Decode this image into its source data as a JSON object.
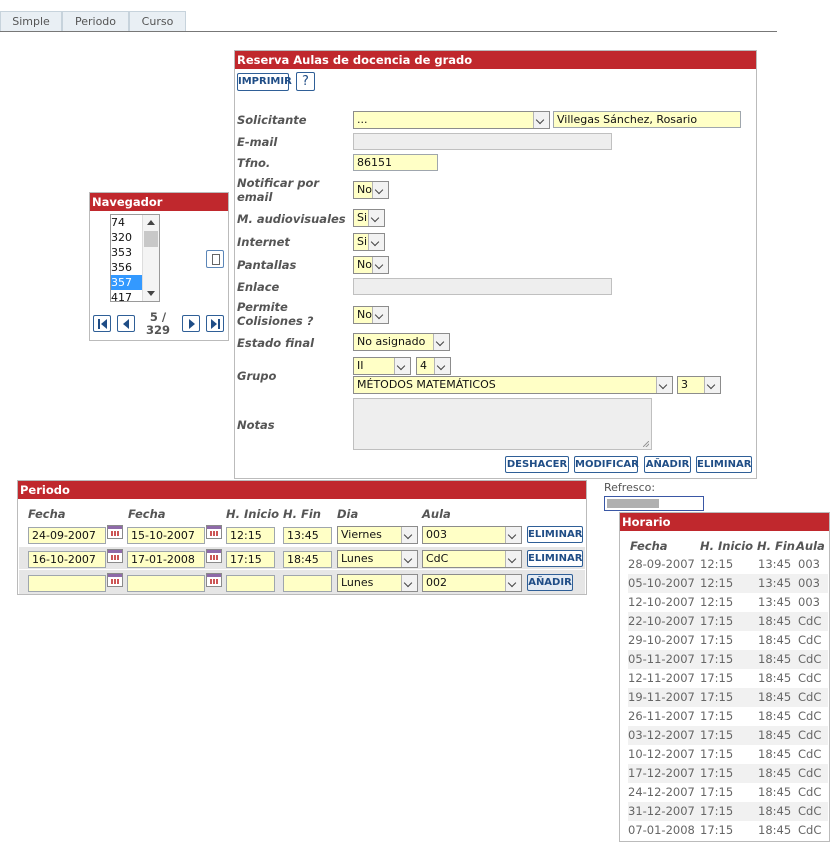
{
  "tabs": [
    "Simple",
    "Periodo",
    "Curso"
  ],
  "reserva": {
    "title": "Reserva Aulas de docencia de grado",
    "print_label": "IMPRIMIR",
    "help_label": "?",
    "labels": {
      "solicitante": "Solicitante",
      "email": "E-mail",
      "tfno": "Tfno.",
      "notificar": "Notificar por email",
      "audiovisuales": "M. audiovisuales",
      "internet": "Internet",
      "pantallas": "Pantallas",
      "enlace": "Enlace",
      "colisiones": "Permite Colisiones ?",
      "estado": "Estado final",
      "grupo": "Grupo",
      "notas": "Notas"
    },
    "values": {
      "solicitante_select": "...",
      "solicitante_name": "Villegas Sánchez, Rosario",
      "email": "",
      "tfno": "86151",
      "notificar": "No",
      "audiovisuales": "Si",
      "internet": "Si",
      "pantallas": "No",
      "enlace": "",
      "colisiones": "No",
      "estado": "No asignado",
      "grupo_a": "II",
      "grupo_b": "4",
      "asignatura": "MÉTODOS MATEMÁTICOS",
      "grupo_c": "3",
      "notas": ""
    },
    "buttons": {
      "deshacer": "DESHACER",
      "modificar": "MODIFICAR",
      "anadir": "AÑADIR",
      "eliminar": "ELIMINAR"
    }
  },
  "navegador": {
    "title": "Navegador",
    "items": [
      "74",
      "320",
      "353",
      "356",
      "357",
      "417"
    ],
    "selected": "357",
    "page": "5 /",
    "total": "329"
  },
  "periodo": {
    "title": "Periodo",
    "headers": [
      "Fecha",
      "Fecha",
      "H. Inicio",
      "H. Fin",
      "Dia",
      "Aula"
    ],
    "rows": [
      {
        "desde": "24-09-2007",
        "hasta": "15-10-2007",
        "inicio": "12:15",
        "fin": "13:45",
        "dia": "Viernes",
        "aula": "003",
        "action": "ELIMINAR"
      },
      {
        "desde": "16-10-2007",
        "hasta": "17-01-2008",
        "inicio": "17:15",
        "fin": "18:45",
        "dia": "Lunes",
        "aula": "CdC",
        "action": "ELIMINAR"
      },
      {
        "desde": "",
        "hasta": "",
        "inicio": "",
        "fin": "",
        "dia": "Lunes",
        "aula": "002",
        "action": "AÑADIR"
      }
    ]
  },
  "refresco": {
    "label": "Refresco:"
  },
  "horario": {
    "title": "Horario",
    "headers": [
      "Fecha",
      "H. Inicio",
      "H. Fin",
      "Aula"
    ],
    "rows": [
      [
        "28-09-2007",
        "12:15",
        "13:45",
        "003"
      ],
      [
        "05-10-2007",
        "12:15",
        "13:45",
        "003"
      ],
      [
        "12-10-2007",
        "12:15",
        "13:45",
        "003"
      ],
      [
        "22-10-2007",
        "17:15",
        "18:45",
        "CdC"
      ],
      [
        "29-10-2007",
        "17:15",
        "18:45",
        "CdC"
      ],
      [
        "05-11-2007",
        "17:15",
        "18:45",
        "CdC"
      ],
      [
        "12-11-2007",
        "17:15",
        "18:45",
        "CdC"
      ],
      [
        "19-11-2007",
        "17:15",
        "18:45",
        "CdC"
      ],
      [
        "26-11-2007",
        "17:15",
        "18:45",
        "CdC"
      ],
      [
        "03-12-2007",
        "17:15",
        "18:45",
        "CdC"
      ],
      [
        "10-12-2007",
        "17:15",
        "18:45",
        "CdC"
      ],
      [
        "17-12-2007",
        "17:15",
        "18:45",
        "CdC"
      ],
      [
        "24-12-2007",
        "17:15",
        "18:45",
        "CdC"
      ],
      [
        "31-12-2007",
        "17:15",
        "18:45",
        "CdC"
      ],
      [
        "07-01-2008",
        "17:15",
        "18:45",
        "CdC"
      ]
    ]
  }
}
